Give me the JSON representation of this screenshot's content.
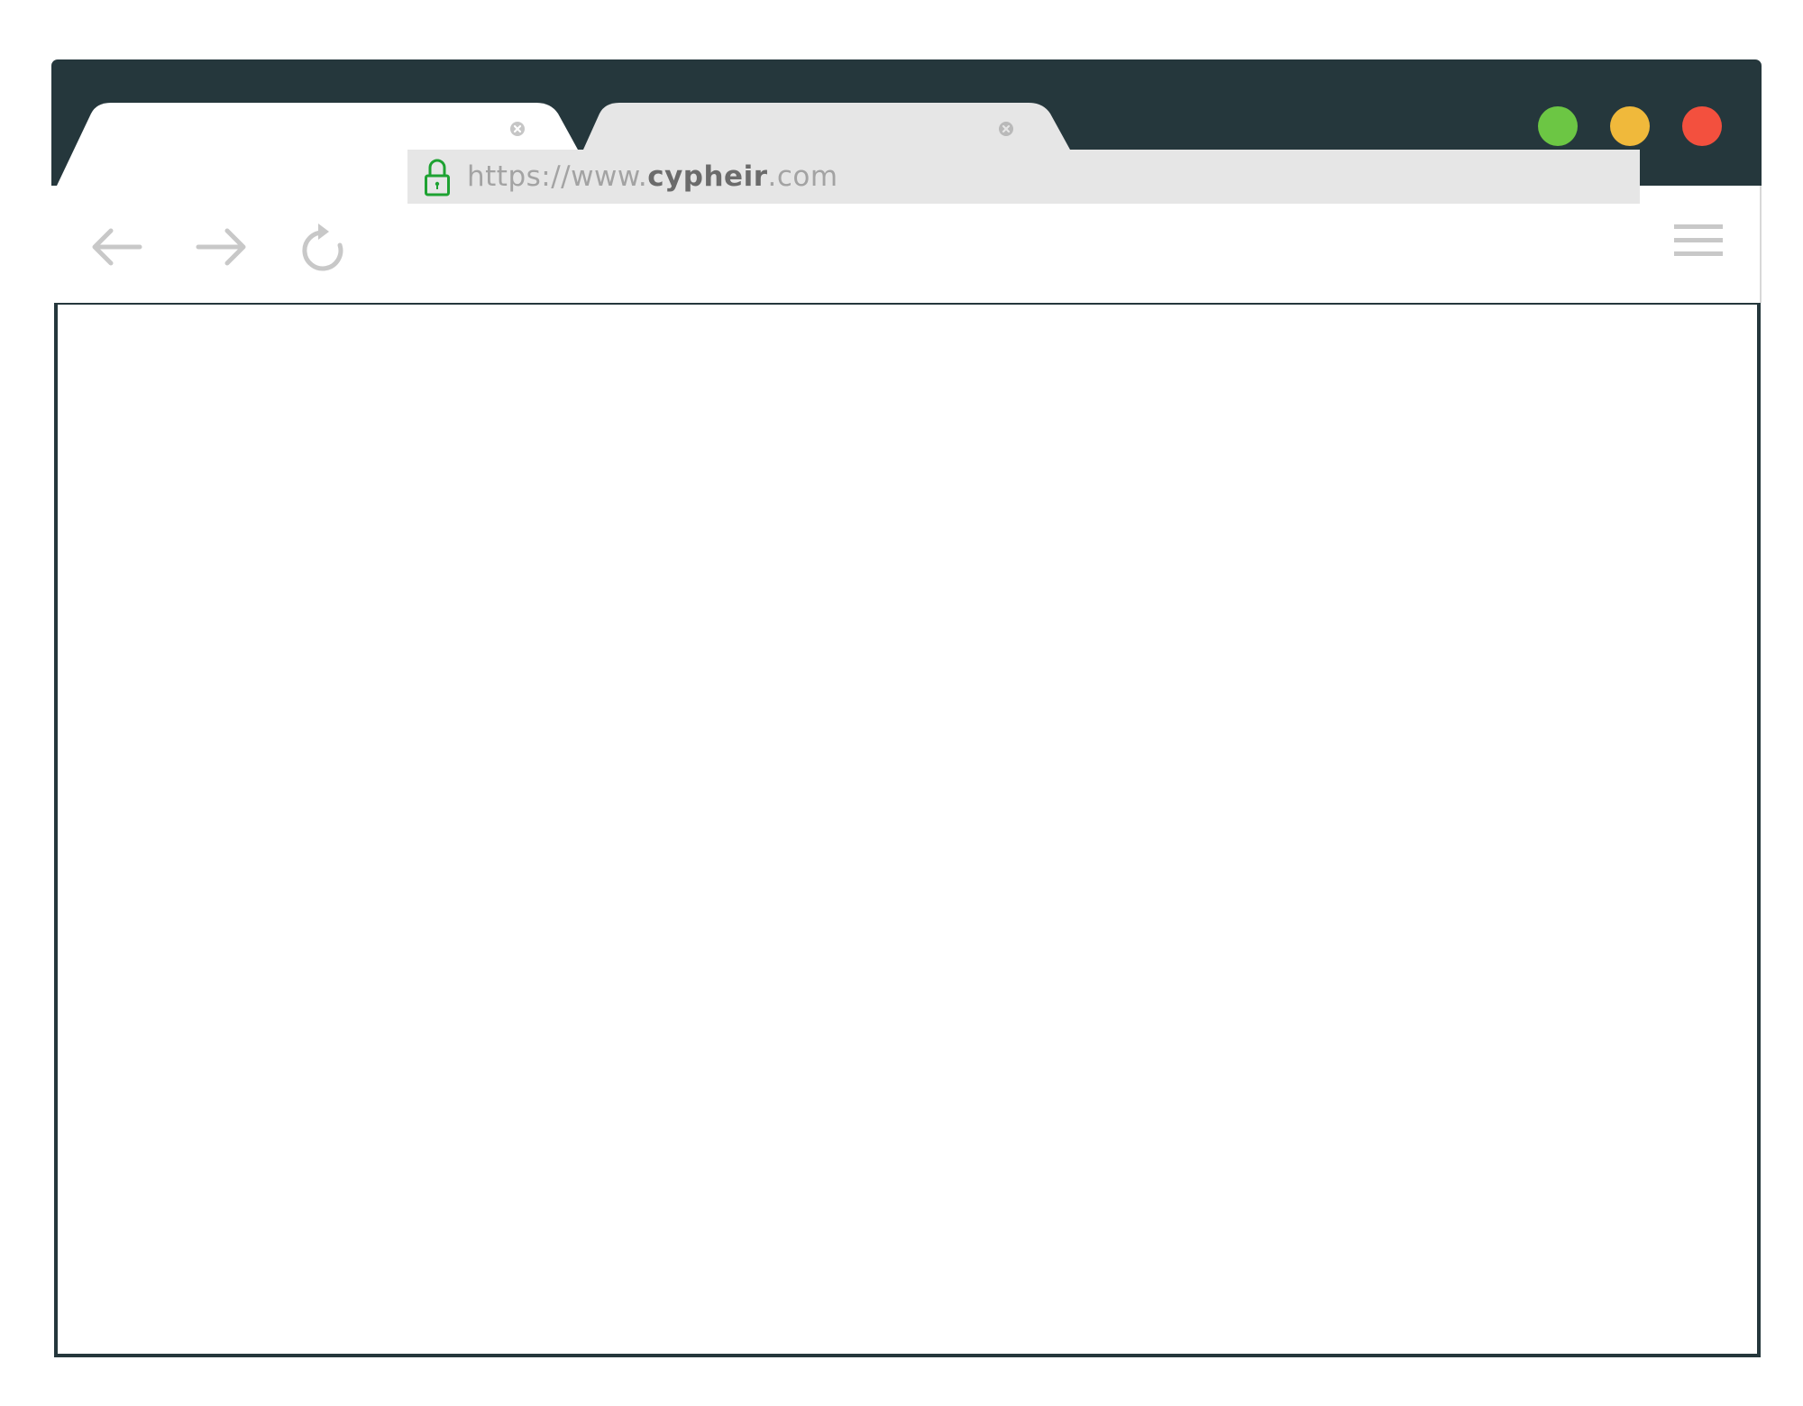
{
  "browser": {
    "tabs": [
      {
        "title": "",
        "active": true
      },
      {
        "title": "",
        "active": false
      }
    ],
    "window_controls": {
      "colors": {
        "green": "#6cc644",
        "yellow": "#f0b93b",
        "red": "#f3503e"
      }
    },
    "toolbar": {
      "icons": [
        "back-arrow-icon",
        "forward-arrow-icon",
        "reload-icon",
        "menu-icon"
      ]
    },
    "address": {
      "secure": true,
      "lock_color": "#1ea232",
      "url_scheme": "https://",
      "url_prefix": "www.",
      "url_domain": "cypheir",
      "url_tld": ".com"
    },
    "colors": {
      "frame": "#25373c",
      "active_tab": "#ffffff",
      "inactive_tab": "#e6e6e6",
      "address_bg": "#e6e6e6",
      "icon_gray": "#c8c8c8"
    }
  }
}
